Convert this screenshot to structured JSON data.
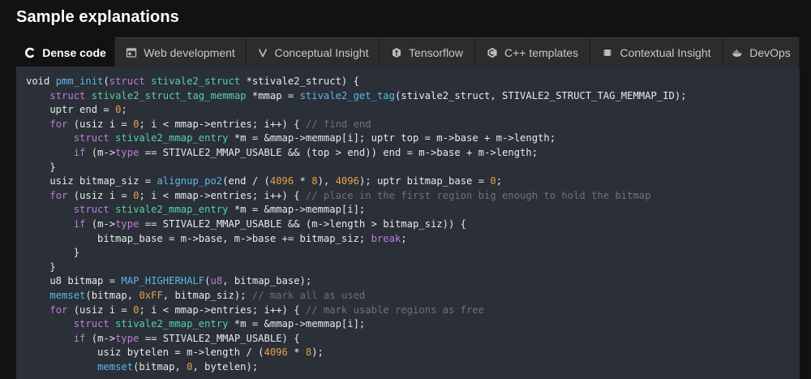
{
  "heading": "Sample explanations",
  "tabs": [
    {
      "label": "Dense code",
      "icon": "c-logo-icon",
      "active": true
    },
    {
      "label": "Web development",
      "icon": "window-icon",
      "active": false
    },
    {
      "label": "Conceptual Insight",
      "icon": "v-logo-icon",
      "active": false
    },
    {
      "label": "Tensorflow",
      "icon": "tensorflow-icon",
      "active": false
    },
    {
      "label": "C++ templates",
      "icon": "cpp-logo-icon",
      "active": false
    },
    {
      "label": "Contextual Insight",
      "icon": "chip-icon",
      "active": false
    },
    {
      "label": "DevOps",
      "icon": "docker-icon",
      "active": false
    }
  ],
  "code_lines": [
    [
      [
        "p",
        "void "
      ],
      [
        "fn",
        "pmm_init"
      ],
      [
        "p",
        "("
      ],
      [
        "kw",
        "struct "
      ],
      [
        "ty",
        "stivale2_struct"
      ],
      [
        "p",
        " *stivale2_struct) {"
      ]
    ],
    [
      [
        "p",
        "    "
      ],
      [
        "kw",
        "struct "
      ],
      [
        "ty",
        "stivale2_struct_tag_memmap"
      ],
      [
        "p",
        " *mmap = "
      ],
      [
        "fn",
        "stivale2_get_tag"
      ],
      [
        "p",
        "(stivale2_struct, STIVALE2_STRUCT_TAG_MEMMAP_ID);"
      ]
    ],
    [
      [
        "p",
        "    uptr end = "
      ],
      [
        "num",
        "0"
      ],
      [
        "p",
        ";"
      ]
    ],
    [
      [
        "p",
        "    "
      ],
      [
        "kw",
        "for"
      ],
      [
        "p",
        " (usiz i = "
      ],
      [
        "num",
        "0"
      ],
      [
        "p",
        "; i < mmap->entries; i++) { "
      ],
      [
        "cm",
        "// find end"
      ]
    ],
    [
      [
        "p",
        "        "
      ],
      [
        "kw",
        "struct "
      ],
      [
        "ty",
        "stivale2_mmap_entry"
      ],
      [
        "p",
        " *m = &mmap->memmap[i]; uptr top = m->base + m->length;"
      ]
    ],
    [
      [
        "p",
        "        "
      ],
      [
        "kw",
        "if"
      ],
      [
        "p",
        " (m->"
      ],
      [
        "kw",
        "type"
      ],
      [
        "p",
        " == STIVALE2_MMAP_USABLE && (top > end)) end = m->base + m->length;"
      ]
    ],
    [
      [
        "p",
        "    }"
      ]
    ],
    [
      [
        "p",
        "    usiz bitmap_siz = "
      ],
      [
        "fn",
        "alignup_po2"
      ],
      [
        "p",
        "(end / ("
      ],
      [
        "num",
        "4096"
      ],
      [
        "p",
        " * "
      ],
      [
        "num",
        "8"
      ],
      [
        "p",
        "), "
      ],
      [
        "num",
        "4096"
      ],
      [
        "p",
        "); uptr bitmap_base = "
      ],
      [
        "num",
        "0"
      ],
      [
        "p",
        ";"
      ]
    ],
    [
      [
        "p",
        "    "
      ],
      [
        "kw",
        "for"
      ],
      [
        "p",
        " (usiz i = "
      ],
      [
        "num",
        "0"
      ],
      [
        "p",
        "; i < mmap->entries; i++) { "
      ],
      [
        "cm",
        "// place in the first region big enough to hold the bitmap"
      ]
    ],
    [
      [
        "p",
        "        "
      ],
      [
        "kw",
        "struct "
      ],
      [
        "ty",
        "stivale2_mmap_entry"
      ],
      [
        "p",
        " *m = &mmap->memmap[i];"
      ]
    ],
    [
      [
        "p",
        "        "
      ],
      [
        "kw",
        "if"
      ],
      [
        "p",
        " (m->"
      ],
      [
        "kw",
        "type"
      ],
      [
        "p",
        " == STIVALE2_MMAP_USABLE && (m->length > bitmap_siz)) {"
      ]
    ],
    [
      [
        "p",
        "            bitmap_base = m->base, m->base += bitmap_siz; "
      ],
      [
        "kw",
        "break"
      ],
      [
        "p",
        ";"
      ]
    ],
    [
      [
        "p",
        "        }"
      ]
    ],
    [
      [
        "p",
        "    }"
      ]
    ],
    [
      [
        "p",
        "    u8 bitmap = "
      ],
      [
        "fn",
        "MAP_HIGHERHALF"
      ],
      [
        "p",
        "("
      ],
      [
        "kw",
        "u8"
      ],
      [
        "p",
        ", bitmap_base);"
      ]
    ],
    [
      [
        "p",
        "    "
      ],
      [
        "fn",
        "memset"
      ],
      [
        "p",
        "(bitmap, "
      ],
      [
        "num",
        "0xFF"
      ],
      [
        "p",
        ", bitmap_siz); "
      ],
      [
        "cm",
        "// mark all as used"
      ]
    ],
    [
      [
        "p",
        "    "
      ],
      [
        "kw",
        "for"
      ],
      [
        "p",
        " (usiz i = "
      ],
      [
        "num",
        "0"
      ],
      [
        "p",
        "; i < mmap->entries; i++) { "
      ],
      [
        "cm",
        "// mark usable regions as free"
      ]
    ],
    [
      [
        "p",
        "        "
      ],
      [
        "kw",
        "struct "
      ],
      [
        "ty",
        "stivale2_mmap_entry"
      ],
      [
        "p",
        " *m = &mmap->memmap[i];"
      ]
    ],
    [
      [
        "p",
        "        "
      ],
      [
        "kw",
        "if"
      ],
      [
        "p",
        " (m->"
      ],
      [
        "kw",
        "type"
      ],
      [
        "p",
        " == STIVALE2_MMAP_USABLE) {"
      ]
    ],
    [
      [
        "p",
        "            usiz bytelen = m->length / ("
      ],
      [
        "num",
        "4096"
      ],
      [
        "p",
        " * "
      ],
      [
        "num",
        "8"
      ],
      [
        "p",
        ");"
      ]
    ],
    [
      [
        "p",
        "            "
      ],
      [
        "fn",
        "memset"
      ],
      [
        "p",
        "(bitmap, "
      ],
      [
        "num",
        "0"
      ],
      [
        "p",
        ", bytelen);"
      ]
    ]
  ],
  "colors": {
    "keyword": "#c07dd6",
    "function": "#5cb8e6",
    "type": "#56d2a6",
    "number": "#e6a24a",
    "comment": "#6a7380",
    "code_bg": "#2a2f38",
    "tab_bg": "#2c2c2c"
  }
}
